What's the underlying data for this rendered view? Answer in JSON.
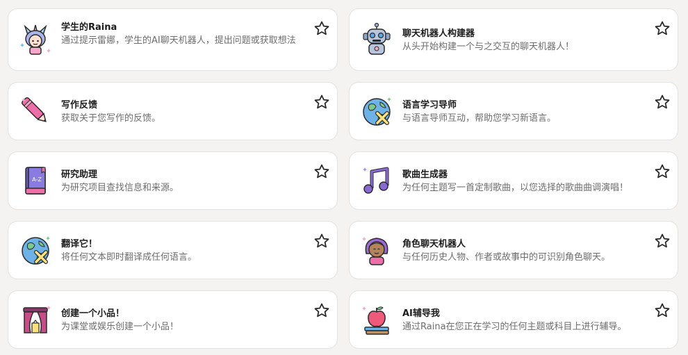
{
  "cards": [
    {
      "title": "学生的Raina",
      "desc": "通过提示雷娜，学生的AI聊天机器人，提出问题或获取想法",
      "icon": "unicorn-girl-icon"
    },
    {
      "title": "聊天机器人构建器",
      "desc": "从头开始构建一个与之交互的聊天机器人！",
      "icon": "robot-icon"
    },
    {
      "title": "写作反馈",
      "desc": "获取关于您写作的反馈。",
      "icon": "pen-icon"
    },
    {
      "title": "语言学习导师",
      "desc": "与语言导师互动，帮助您学习新语言。",
      "icon": "globe-icon"
    },
    {
      "title": "研究助理",
      "desc": "为研究项目查找信息和来源。",
      "icon": "book-icon"
    },
    {
      "title": "歌曲生成器",
      "desc": "为任何主题写一首定制歌曲，以您选择的歌曲曲调演唱！",
      "icon": "music-note-icon"
    },
    {
      "title": "翻译它！",
      "desc": "将任何文本即时翻译成任何语言。",
      "icon": "globe-icon"
    },
    {
      "title": "角色聊天机器人",
      "desc": "与任何历史人物、作者或故事中的可识别角色聊天。",
      "icon": "character-girl-icon"
    },
    {
      "title": "创建一个小品！",
      "desc": "为课堂或娱乐创建一个小品！",
      "icon": "theater-curtain-icon"
    },
    {
      "title": "AI辅导我",
      "desc": "通过Raina在您正在学习的任何主题或科目上进行辅导。",
      "icon": "apple-books-icon"
    }
  ]
}
